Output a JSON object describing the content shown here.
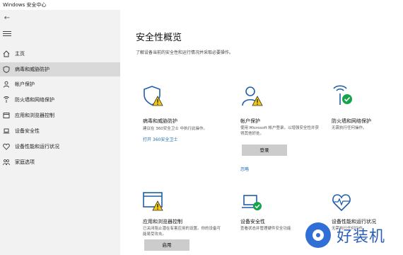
{
  "window": {
    "title": "Windows 安全中心"
  },
  "sidebar": {
    "items": [
      {
        "label": "主页",
        "icon": "home-icon"
      },
      {
        "label": "病毒和威胁防护",
        "icon": "shield-icon",
        "active": true
      },
      {
        "label": "帐户保护",
        "icon": "person-icon"
      },
      {
        "label": "防火墙和网络保护",
        "icon": "wifi-icon"
      },
      {
        "label": "应用和浏览器控制",
        "icon": "window-icon"
      },
      {
        "label": "设备安全性",
        "icon": "laptop-icon"
      },
      {
        "label": "设备性能和运行状况",
        "icon": "heart-icon"
      },
      {
        "label": "家庭选项",
        "icon": "family-icon"
      }
    ]
  },
  "main": {
    "title": "安全性概览",
    "subtitle": "了解设备当前的安全性和运行情况并采取必要操作。",
    "cards": [
      {
        "title": "病毒和威胁防护",
        "desc": "建议在 360安全卫士 中执行此操作。",
        "link": "打开 360安全卫士",
        "icon": "shield-warning-icon"
      },
      {
        "title": "帐户保护",
        "desc": "使用 Microsoft 帐户登录，以增强安全性并获得其他好处。",
        "button": "登录",
        "link": "忽略",
        "icon": "person-warning-icon"
      },
      {
        "title": "防火墙和网络保护",
        "desc": "无需执行任何操作。",
        "icon": "wifi-check-icon"
      },
      {
        "title": "应用和浏览器控制",
        "desc": "已关闭阻止潜在有害应用的设置。你的设备可能易受攻击。",
        "button": "启用",
        "icon": "browser-warning-icon"
      },
      {
        "title": "设备安全性",
        "desc": "查看状态并管理硬件安全功能",
        "icon": "laptop-check-icon"
      },
      {
        "title": "设备性能和运行状况",
        "desc": "无需执行任何操作。",
        "icon": "heart-pulse-icon"
      }
    ]
  },
  "watermark": {
    "text": "好装机"
  },
  "colors": {
    "accent": "#1f6fb5",
    "warning": "#f2c811",
    "success": "#16a34a",
    "sidebar_bg": "#f2f2f2"
  }
}
